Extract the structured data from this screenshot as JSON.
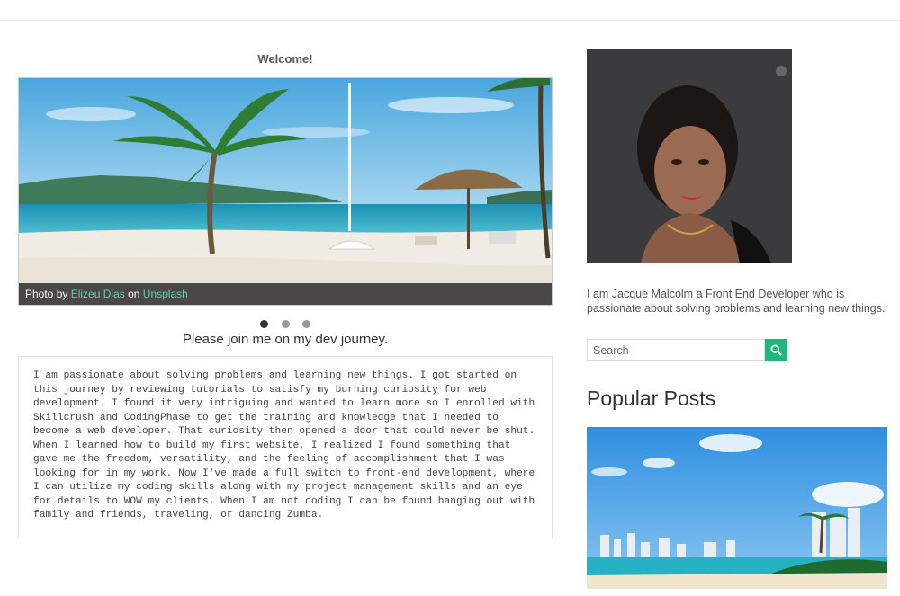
{
  "main": {
    "welcome": "Welcome!",
    "slider": {
      "caption_prefix": "Photo by",
      "author": "Elizeu Dias",
      "connector": "on",
      "source": "Unsplash",
      "slides": 3,
      "active_slide": 1
    },
    "subtitle": "Please join me on my dev journey.",
    "paragraph": "I am passionate about solving problems and learning new things. I got started on this journey by reviewing tutorials to satisfy my burning curiosity for web development. I found it very intriguing and wanted to learn more so I enrolled with Skillcrush and CodingPhase to get the training and knowledge that I needed to become a web developer. That curiosity then opened a door that could never be shut. When I learned how to build my first website, I realized I found something that gave me the freedom, versatility, and the feeling of accomplishment that I was looking for in my work. Now I've made a full switch to front-end development, where I can utilize my coding skills along with my project management skills and an eye for details to WOW my clients. When I am not coding I can be found hanging out with family and friends, traveling, or dancing Zumba."
  },
  "sidebar": {
    "bio": "I am Jacque Malcolm a Front End Developer who is passionate about solving problems and learning new things.",
    "search": {
      "placeholder": "Search",
      "value": ""
    },
    "popular_title": "Popular Posts"
  },
  "colors": {
    "accent": "#22b77a",
    "link": "#62d0a6",
    "caption_bg": "#323232"
  },
  "icons": {
    "search_button": "search-icon"
  }
}
